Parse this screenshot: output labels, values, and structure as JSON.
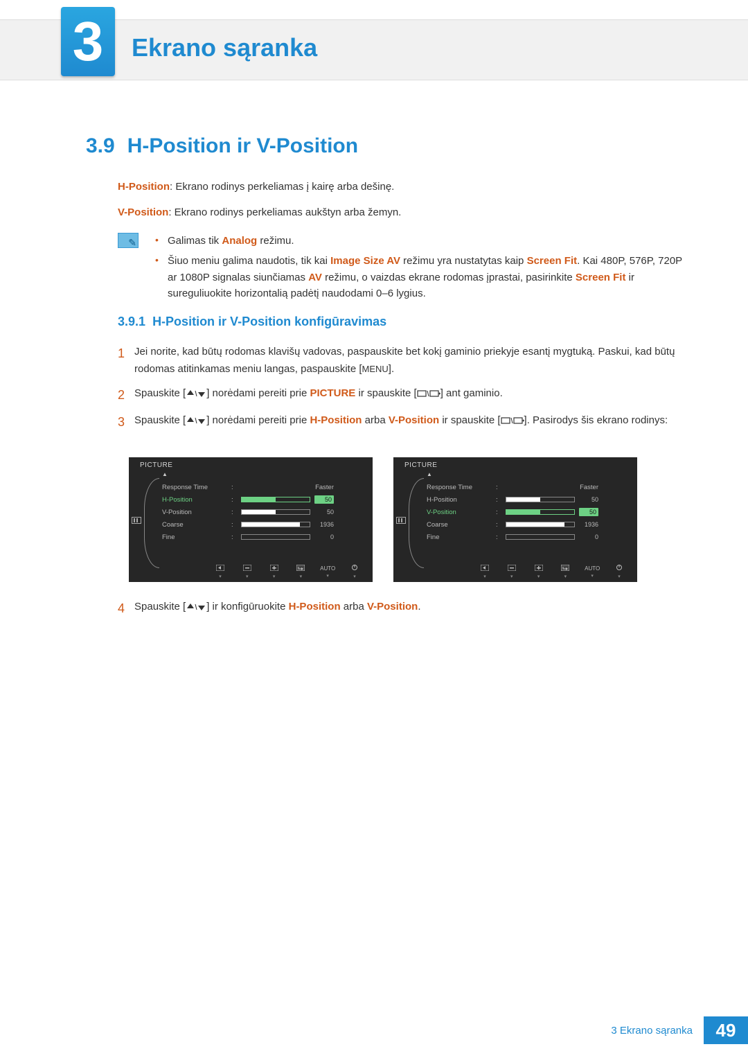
{
  "chapter": {
    "number": "3",
    "title": "Ekrano sąranka"
  },
  "section": {
    "number": "3.9",
    "title": "H-Position ir V-Position"
  },
  "intro": {
    "hpos_label": "H-Position",
    "hpos_text": ": Ekrano rodinys perkeliamas į kairę arba dešinę.",
    "vpos_label": "V-Position",
    "vpos_text": ": Ekrano rodinys perkeliamas aukštyn arba žemyn."
  },
  "notes": {
    "n1_a": "Galimas tik ",
    "n1_hl": "Analog",
    "n1_b": " režimu.",
    "n2_a": "Šiuo meniu galima naudotis, tik kai ",
    "n2_hl1": "Image Size AV",
    "n2_b": " režimu yra nustatytas kaip ",
    "n2_hl2": "Screen Fit",
    "n2_c": ". Kai 480P, 576P, 720P ar 1080P signalas siunčiamas ",
    "n2_hl3": "AV",
    "n2_d": " režimu, o vaizdas ekrane rodomas įprastai, pasirinkite ",
    "n2_hl4": "Screen Fit",
    "n2_e": " ir sureguliuokite horizontalią padėtį naudodami 0–6 lygius."
  },
  "subsection": {
    "number": "3.9.1",
    "title": "H-Position ir V-Position konfigūravimas"
  },
  "steps": {
    "s1_a": "Jei norite, kad būtų rodomas klavišų vadovas, paspauskite bet kokį gaminio priekyje esantį mygtuką. Paskui, kad būtų rodomas atitinkamas meniu langas, paspauskite [",
    "s1_menu": "MENU",
    "s1_b": "].",
    "s2_a": "Spauskite [",
    "s2_b": "] norėdami pereiti prie ",
    "s2_hl": "PICTURE",
    "s2_c": " ir spauskite [",
    "s2_d": "] ant gaminio.",
    "s3_a": "Spauskite [",
    "s3_b": "] norėdami pereiti prie ",
    "s3_hl1": "H-Position",
    "s3_or": " arba ",
    "s3_hl2": "V-Position",
    "s3_c": " ir spauskite [",
    "s3_d": "]. Pasirodys šis ekrano rodinys:",
    "s4_a": "Spauskite [",
    "s4_b": "] ir konfigūruokite ",
    "s4_hl1": "H-Position",
    "s4_hl2": "V-Position",
    "s4_c": "."
  },
  "step_numbers": {
    "n1": "1",
    "n2": "2",
    "n3": "3",
    "n4": "4"
  },
  "osd": {
    "title": "PICTURE",
    "items": [
      {
        "label": "Response Time",
        "value_text": "Faster"
      },
      {
        "label": "H-Position",
        "bar": 50,
        "num": "50"
      },
      {
        "label": "V-Position",
        "bar": 50,
        "num": "50"
      },
      {
        "label": "Coarse",
        "bar": 86,
        "num": "1936"
      },
      {
        "label": "Fine",
        "bar": 0,
        "num": "0"
      }
    ],
    "left_active_index": 1,
    "right_active_index": 2,
    "bottom_auto": "AUTO"
  },
  "footer": {
    "text": "3 Ekrano sąranka",
    "page": "49"
  }
}
